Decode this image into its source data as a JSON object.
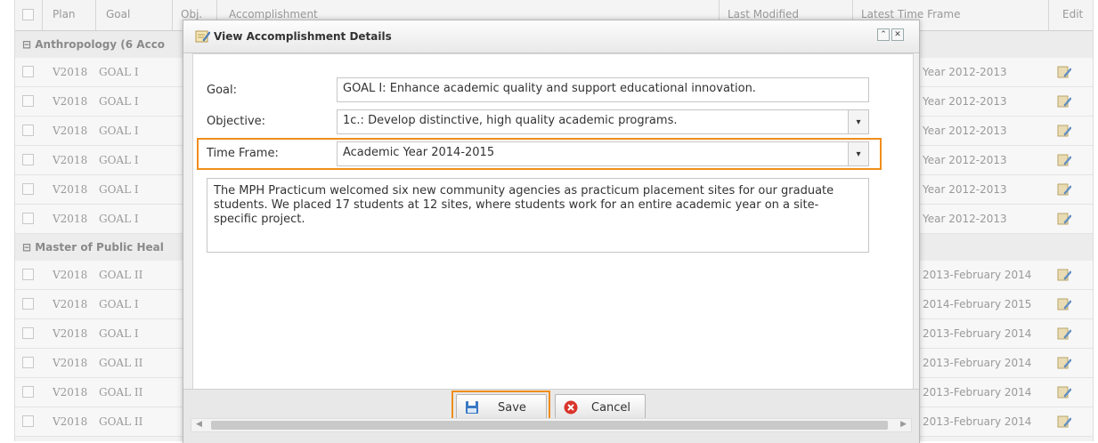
{
  "grid": {
    "columns": {
      "plan": "Plan",
      "goal": "Goal",
      "objective": "Obj.",
      "accomplishment": "Accomplishment",
      "last_modified": "Last Modified",
      "latest_time_frame": "Latest Time Frame",
      "edit": "Edit"
    },
    "groups": [
      {
        "label": "⊟ Anthropology (6 Acco",
        "rows": [
          {
            "plan": "V2018",
            "goal": "GOAL I",
            "time_frame": "Year 2012-2013"
          },
          {
            "plan": "V2018",
            "goal": "GOAL I",
            "time_frame": "Year 2012-2013"
          },
          {
            "plan": "V2018",
            "goal": "GOAL I",
            "time_frame": "Year 2012-2013"
          },
          {
            "plan": "V2018",
            "goal": "GOAL I",
            "time_frame": "Year 2012-2013"
          },
          {
            "plan": "V2018",
            "goal": "GOAL I",
            "time_frame": "Year 2012-2013"
          },
          {
            "plan": "V2018",
            "goal": "GOAL I",
            "time_frame": "Year 2012-2013"
          }
        ]
      },
      {
        "label": "⊟ Master of Public Heal",
        "rows": [
          {
            "plan": "V2018",
            "goal": "GOAL II",
            "time_frame": "2013-February 2014"
          },
          {
            "plan": "V2018",
            "goal": "GOAL I",
            "time_frame": "2014-February 2015"
          },
          {
            "plan": "V2018",
            "goal": "GOAL I",
            "time_frame": "2013-February 2014"
          },
          {
            "plan": "V2018",
            "goal": "GOAL II",
            "time_frame": "2013-February 2014"
          },
          {
            "plan": "V2018",
            "goal": "GOAL II",
            "time_frame": "2013-February 2014"
          },
          {
            "plan": "V2018",
            "goal": "GOAL II",
            "time_frame": "2013-February 2014"
          }
        ]
      }
    ]
  },
  "dialog": {
    "title": "View Accomplishment Details",
    "goal_label": "Goal:",
    "goal_value": "GOAL I: Enhance academic quality and support educational innovation.",
    "objective_label": "Objective:",
    "objective_value": "1c.: Develop distinctive, high quality academic programs.",
    "time_frame_label": "Time Frame:",
    "time_frame_value": "Academic Year 2014-2015",
    "accomplishment_text": "The MPH Practicum welcomed six new community agencies as practicum placement sites for our graduate students. We placed 17 students at 12 sites, where students work for an entire academic year on a site-specific project.",
    "save_label": "Save",
    "cancel_label": "Cancel"
  },
  "colors": {
    "highlight": "#f08e1b",
    "cancel_icon": "#d9342b",
    "save_icon": "#3a78c4"
  },
  "icons": [
    "edit-icon",
    "pencil-note-icon",
    "collapse-icon",
    "close-icon",
    "dropdown-arrow-icon",
    "floppy-disk-icon",
    "cancel-x-icon"
  ]
}
